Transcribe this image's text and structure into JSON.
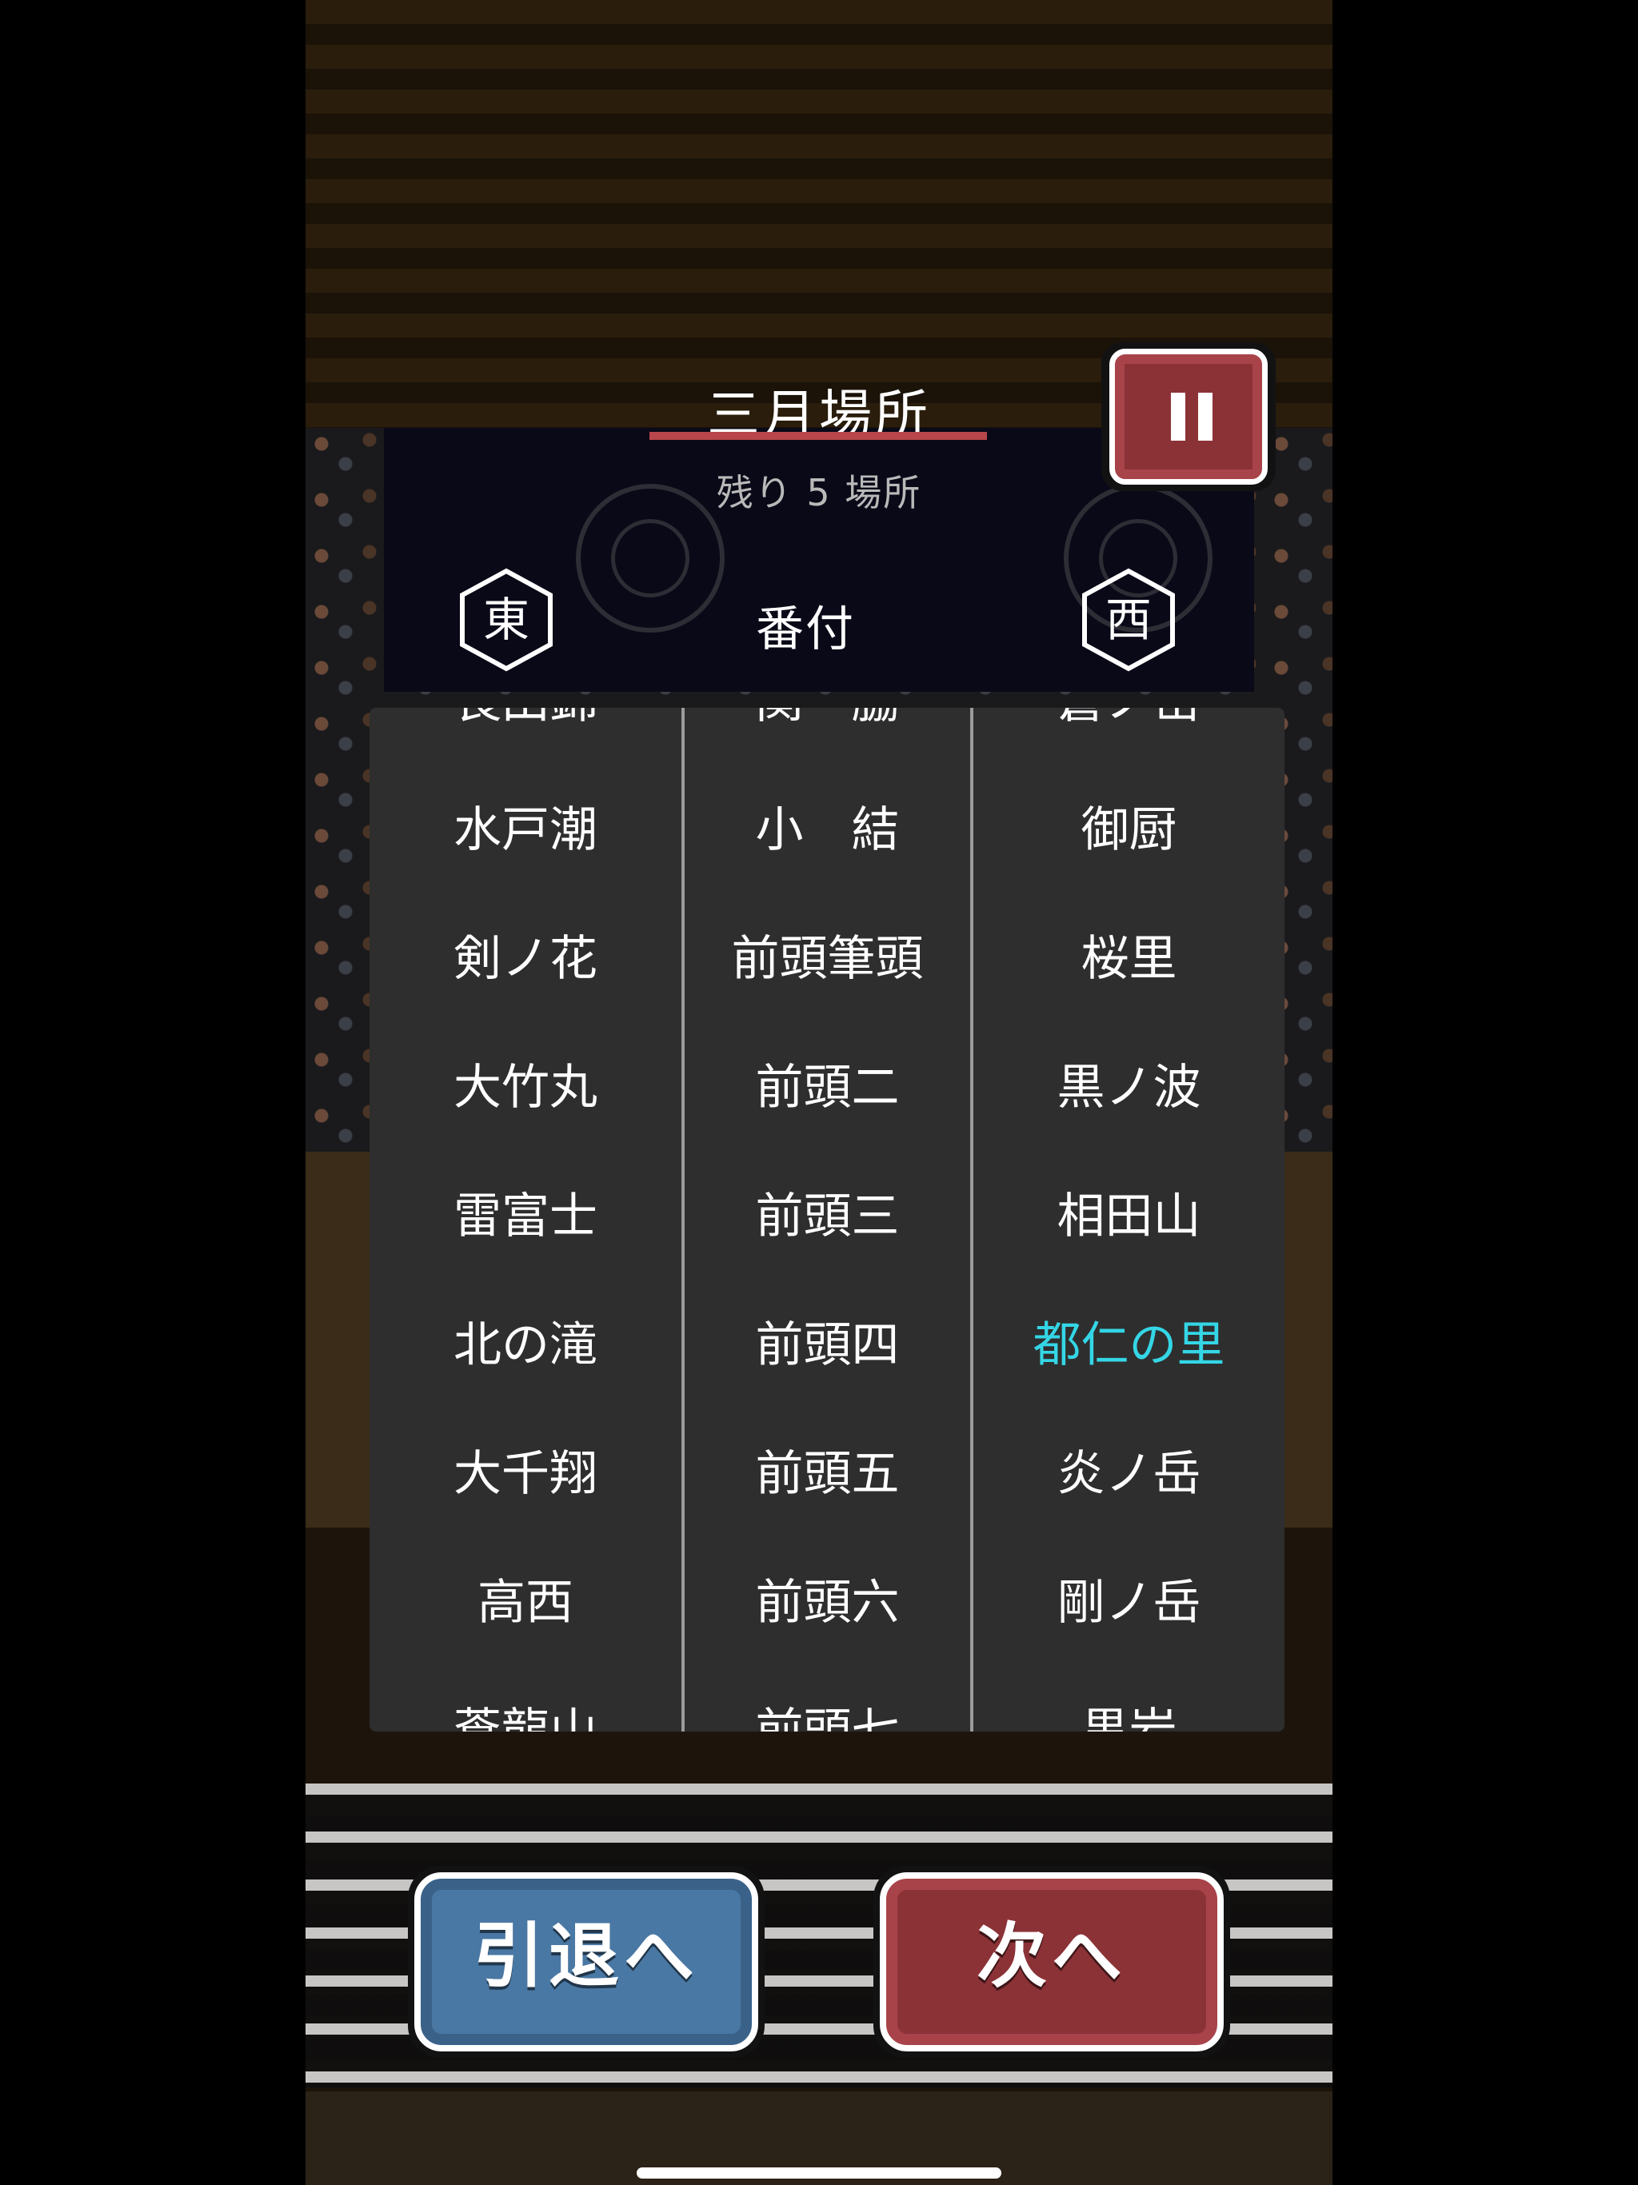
{
  "header": {
    "tournament_title": "三月場所",
    "remaining_label": "残り 5 場所",
    "east_label": "東",
    "west_label": "西",
    "banzuke_label": "番付"
  },
  "controls": {
    "pause_icon": "pause-icon",
    "retire_label": "引退へ",
    "next_label": "次へ"
  },
  "colors": {
    "accent_red": "#b8464b",
    "highlight_cyan": "#34d6e6",
    "retire_blue": "#4a78a4",
    "next_red": "#8b3237"
  },
  "banzuke": {
    "rows": [
      {
        "east": "長田錦",
        "rank": "関　脇",
        "west": "蒼ノ岳"
      },
      {
        "east": "水戸潮",
        "rank": "小　結",
        "west": "御厨"
      },
      {
        "east": "剣ノ花",
        "rank": "前頭筆頭",
        "west": "桜里"
      },
      {
        "east": "大竹丸",
        "rank": "前頭二",
        "west": "黒ノ波"
      },
      {
        "east": "雷富士",
        "rank": "前頭三",
        "west": "相田山"
      },
      {
        "east": "北の滝",
        "rank": "前頭四",
        "west": "都仁の里",
        "highlight": "west"
      },
      {
        "east": "大千翔",
        "rank": "前頭五",
        "west": "炎ノ岳"
      },
      {
        "east": "高西",
        "rank": "前頭六",
        "west": "剛ノ岳"
      },
      {
        "east": "蒼龍山",
        "rank": "前頭七",
        "west": "黒岩"
      }
    ]
  }
}
